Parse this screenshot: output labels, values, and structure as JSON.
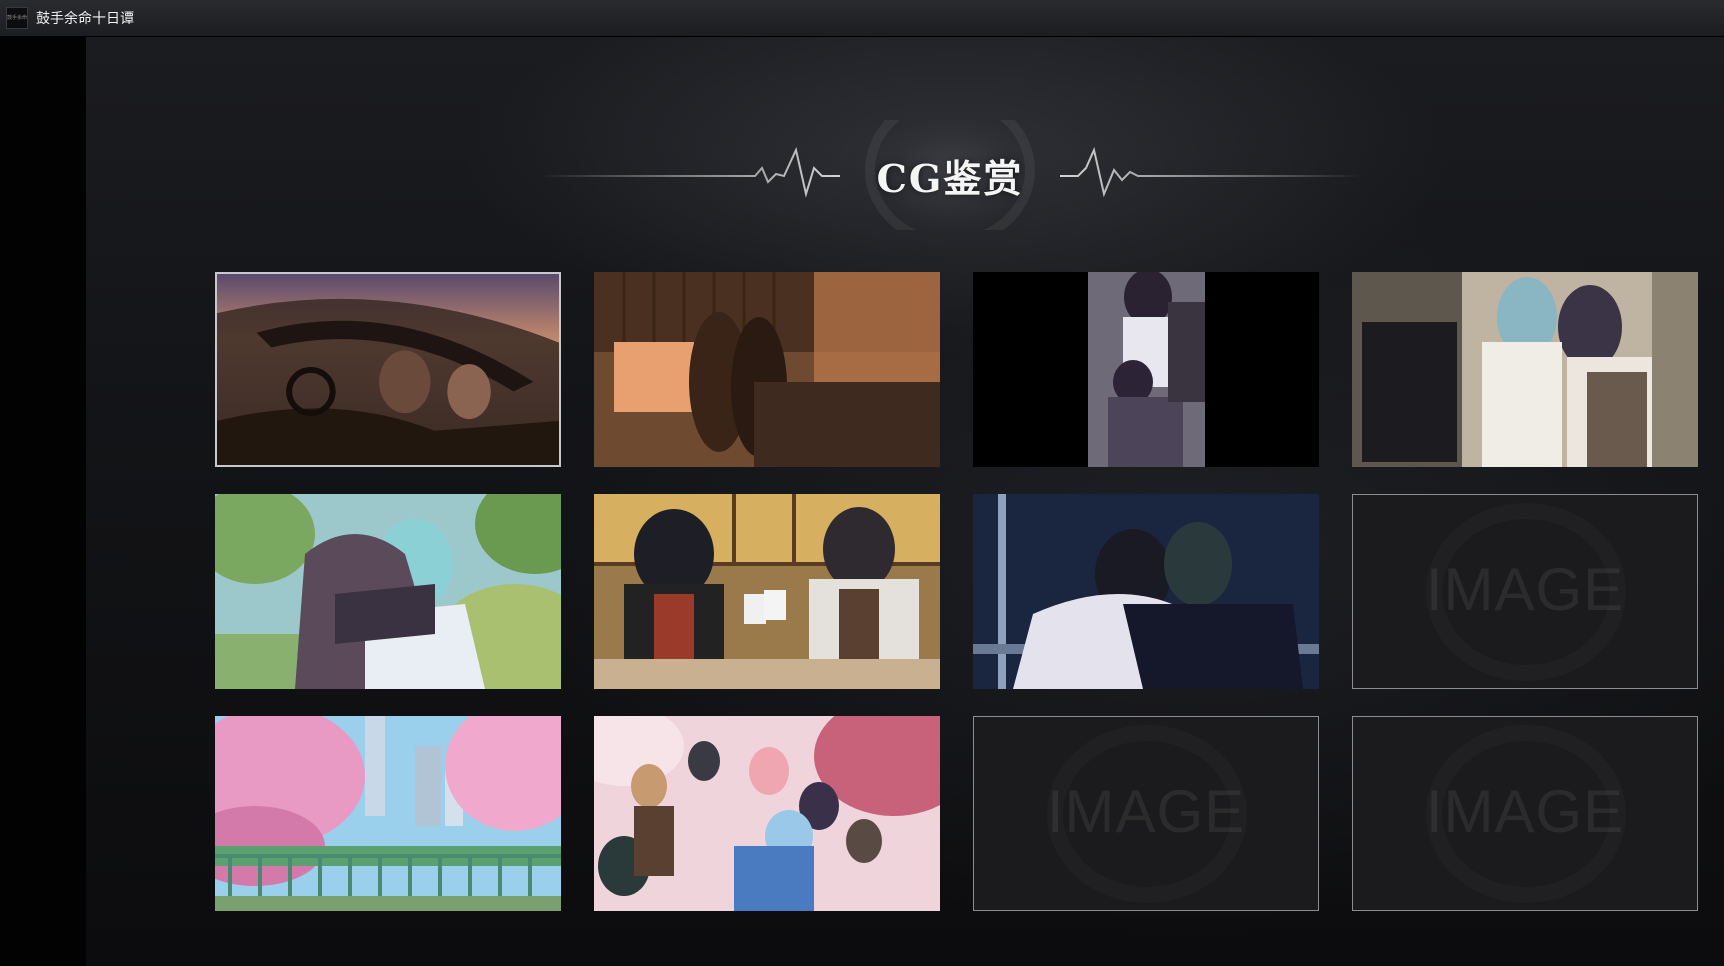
{
  "window": {
    "title": "鼓手余命十日谭",
    "icon_text": "鼓手余命"
  },
  "header": {
    "title": "CG鉴赏"
  },
  "gallery": {
    "placeholder_label": "IMAGE",
    "tiles": [
      {
        "state": "unlocked",
        "selected": true
      },
      {
        "state": "unlocked",
        "selected": false
      },
      {
        "state": "unlocked",
        "selected": false
      },
      {
        "state": "unlocked",
        "selected": false
      },
      {
        "state": "unlocked",
        "selected": false
      },
      {
        "state": "unlocked",
        "selected": false
      },
      {
        "state": "unlocked",
        "selected": false
      },
      {
        "state": "locked",
        "selected": false
      },
      {
        "state": "unlocked",
        "selected": false
      },
      {
        "state": "unlocked",
        "selected": false
      },
      {
        "state": "locked",
        "selected": false
      },
      {
        "state": "locked",
        "selected": false
      }
    ]
  },
  "colors": {
    "background": "#141518",
    "title_text": "#f4f4f4",
    "selected_border": "#c8c8cc",
    "locked_border": "#8d8d90"
  }
}
